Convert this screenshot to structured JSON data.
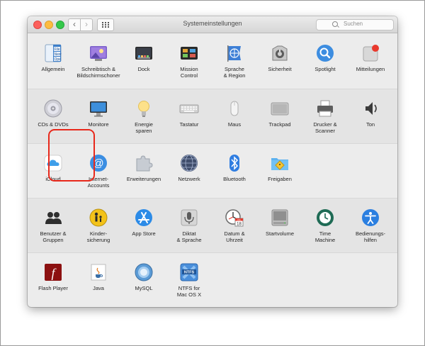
{
  "window": {
    "title": "Systemeinstellungen",
    "search_placeholder": "Suchen",
    "nav_back": "‹",
    "nav_forward": "›"
  },
  "sections": [
    {
      "items": [
        {
          "label": "Allgemein",
          "icon": "general-icon"
        },
        {
          "label": "Schreibtisch &\nBildschirmschoner",
          "icon": "desktop-screensaver-icon"
        },
        {
          "label": "Dock",
          "icon": "dock-icon"
        },
        {
          "label": "Mission\nControl",
          "icon": "mission-control-icon"
        },
        {
          "label": "Sprache\n& Region",
          "icon": "language-region-icon"
        },
        {
          "label": "Sicherheit",
          "icon": "security-icon"
        },
        {
          "label": "Spotlight",
          "icon": "spotlight-icon"
        },
        {
          "label": "Mitteilungen",
          "icon": "notifications-icon"
        }
      ]
    },
    {
      "items": [
        {
          "label": "CDs & DVDs",
          "icon": "cd-dvd-icon"
        },
        {
          "label": "Monitore",
          "icon": "displays-icon"
        },
        {
          "label": "Energie\nsparen",
          "icon": "energy-saver-icon"
        },
        {
          "label": "Tastatur",
          "icon": "keyboard-icon"
        },
        {
          "label": "Maus",
          "icon": "mouse-icon"
        },
        {
          "label": "Trackpad",
          "icon": "trackpad-icon"
        },
        {
          "label": "Drucker &\nScanner",
          "icon": "printer-scanner-icon"
        },
        {
          "label": "Ton",
          "icon": "sound-icon"
        }
      ]
    },
    {
      "items": [
        {
          "label": "iCloud",
          "icon": "icloud-icon"
        },
        {
          "label": "Internet-\nAccounts",
          "icon": "internet-accounts-icon"
        },
        {
          "label": "Erweiterungen",
          "icon": "extensions-icon"
        },
        {
          "label": "Netzwerk",
          "icon": "network-icon"
        },
        {
          "label": "Bluetooth",
          "icon": "bluetooth-icon"
        },
        {
          "label": "Freigaben",
          "icon": "sharing-icon"
        }
      ]
    },
    {
      "items": [
        {
          "label": "Benutzer &\nGruppen",
          "icon": "users-groups-icon"
        },
        {
          "label": "Kinder-\nsicherung",
          "icon": "parental-controls-icon"
        },
        {
          "label": "App Store",
          "icon": "app-store-icon"
        },
        {
          "label": "Diktat\n& Sprache",
          "icon": "dictation-speech-icon"
        },
        {
          "label": "Datum &\nUhrzeit",
          "icon": "date-time-icon"
        },
        {
          "label": "Startvolume",
          "icon": "startup-disk-icon"
        },
        {
          "label": "Time\nMachine",
          "icon": "time-machine-icon"
        },
        {
          "label": "Bedienungs-\nhilfen",
          "icon": "accessibility-icon"
        }
      ]
    },
    {
      "items": [
        {
          "label": "Flash Player",
          "icon": "flash-player-icon"
        },
        {
          "label": "Java",
          "icon": "java-icon"
        },
        {
          "label": "MySQL",
          "icon": "mysql-icon"
        },
        {
          "label": "NTFS for\nMac OS X",
          "icon": "ntfs-icon"
        }
      ]
    }
  ],
  "icon_glyph_text": {
    "general_file": "File",
    "general_new": "New",
    "general_open": "Ope",
    "calendar_day": "18",
    "calendar_month": "JUL",
    "ntfs_text": "NTFS",
    "flash_letter": "f",
    "at_sign": "@"
  },
  "highlight_color": "#e8281b"
}
